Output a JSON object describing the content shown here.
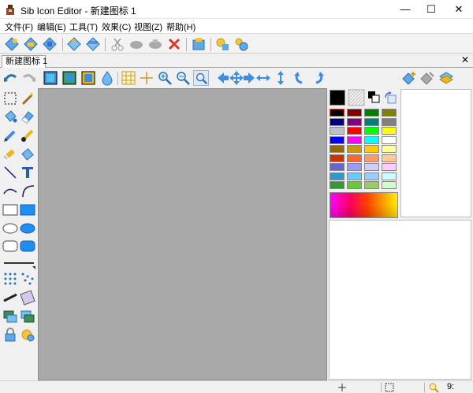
{
  "window": {
    "title": "Sib Icon Editor - 新建图标 1",
    "minimize": "—",
    "maximize": "☐",
    "close": "✕"
  },
  "menu": [
    "文件(F)",
    "编辑(E)",
    "工具(T)",
    "效果(C)",
    "视图(Z)",
    "帮助(H)"
  ],
  "tab": {
    "label": "新建图标 1",
    "close": "✕"
  },
  "colors": {
    "canvas": "#a9a9a9",
    "selected_color": "#000000",
    "palette": [
      [
        "#000000",
        "#800000",
        "#008000",
        "#808000"
      ],
      [
        "#000080",
        "#800080",
        "#008080",
        "#808080"
      ],
      [
        "#c0c0c0",
        "#ff0000",
        "#00ff00",
        "#ffff00"
      ],
      [
        "#0000ff",
        "#ff00ff",
        "#00ffff",
        "#ffffff"
      ],
      [
        "#996600",
        "#cc9900",
        "#ffcc00",
        "#ffff99"
      ],
      [
        "#cc3300",
        "#ff6633",
        "#ff9966",
        "#ffcc99"
      ],
      [
        "#6666cc",
        "#9999ff",
        "#ccccff",
        "#ffccff"
      ],
      [
        "#3399cc",
        "#66ccff",
        "#99ccff",
        "#ccffff"
      ],
      [
        "#339933",
        "#66cc33",
        "#99cc66",
        "#ccffcc"
      ]
    ]
  },
  "status": {
    "zoom": "9:"
  }
}
